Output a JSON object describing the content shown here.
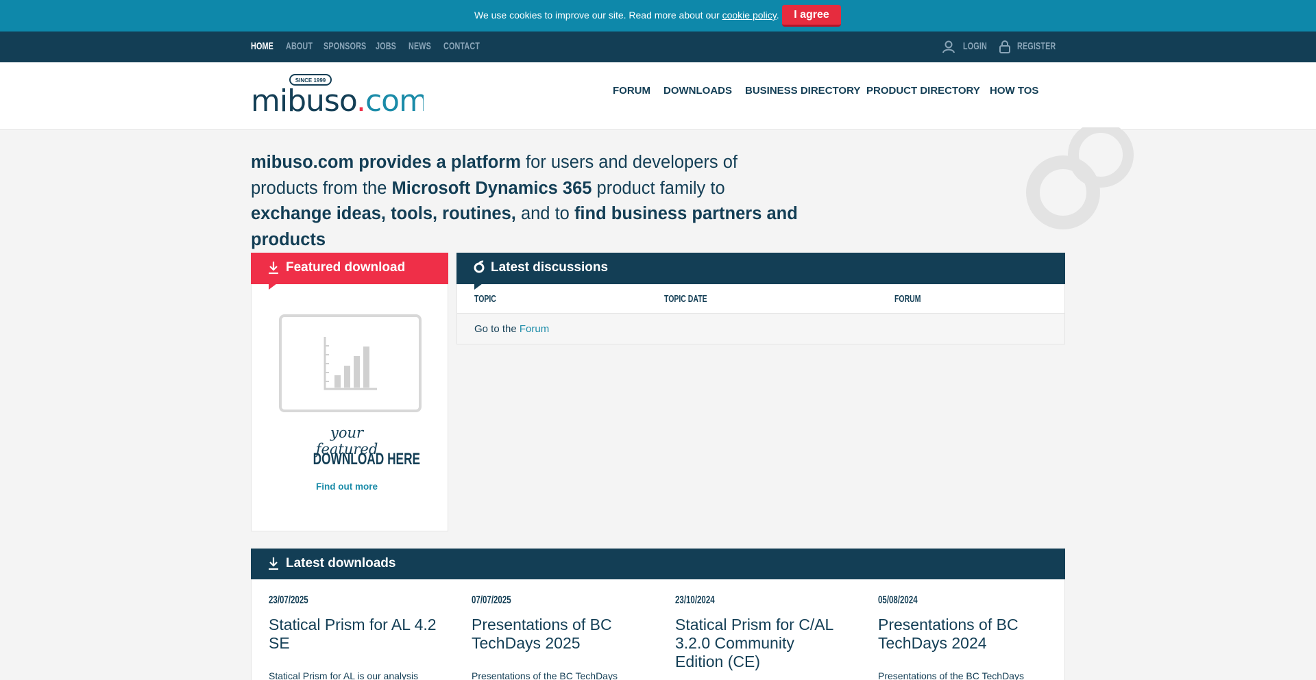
{
  "cookie": {
    "text": "We use cookies to improve our site. Read more about our ",
    "link": "cookie policy",
    "period": ".",
    "agree_label": "I agree"
  },
  "topnav": {
    "links": [
      "HOME",
      "ABOUT",
      "SPONSORS",
      "JOBS",
      "NEWS",
      "CONTACT"
    ],
    "login": "LOGIN",
    "register": "REGISTER"
  },
  "logo": {
    "badge": "SINCE 1999",
    "name_main": "mibuso",
    "name_dot": ".",
    "name_tld": "com"
  },
  "mainnav": [
    "FORUM",
    "DOWNLOADS",
    "BUSINESS DIRECTORY",
    "PRODUCT DIRECTORY",
    "HOW TOS"
  ],
  "hero": {
    "p1": "mibuso.com provides a platform",
    "p2": " for users and developers of products from the ",
    "p3": "Microsoft Dynamics 365",
    "p4": " product family to ",
    "p5": "exchange ideas, tools, routines,",
    "p6": " and to ",
    "p7": "find business partners and products"
  },
  "featured": {
    "title": "Featured download",
    "script": "your featured",
    "big": "DOWNLOAD HERE",
    "link": "Find out more"
  },
  "discussions": {
    "title": "Latest discussions",
    "columns": [
      "TOPIC",
      "TOPIC DATE",
      "FORUM"
    ],
    "goto_text": "Go to the ",
    "goto_link": "Forum"
  },
  "downloads": {
    "title": "Latest downloads",
    "items": [
      {
        "date": "23/07/2025",
        "title": "Statical Prism for AL 4.2 SE",
        "desc": "Statical Prism for AL is our analysis"
      },
      {
        "date": "07/07/2025",
        "title": "Presentations of BC TechDays 2025",
        "desc": "Presentations of the BC TechDays"
      },
      {
        "date": "23/10/2024",
        "title": "Statical Prism for C/AL 3.2.0 Community Edition (CE)",
        "desc": ""
      },
      {
        "date": "05/08/2024",
        "title": "Presentations of BC TechDays 2024",
        "desc": "Presentations of the BC TechDays"
      }
    ]
  },
  "colors": {
    "cookie_bar": "#0e88aa",
    "navy": "#133e55",
    "red": "#ef2f48",
    "link": "#1a8ba8"
  },
  "icons": [
    "user-icon",
    "lock-icon",
    "download-icon",
    "discussion-icon",
    "chart-placeholder-icon"
  ]
}
